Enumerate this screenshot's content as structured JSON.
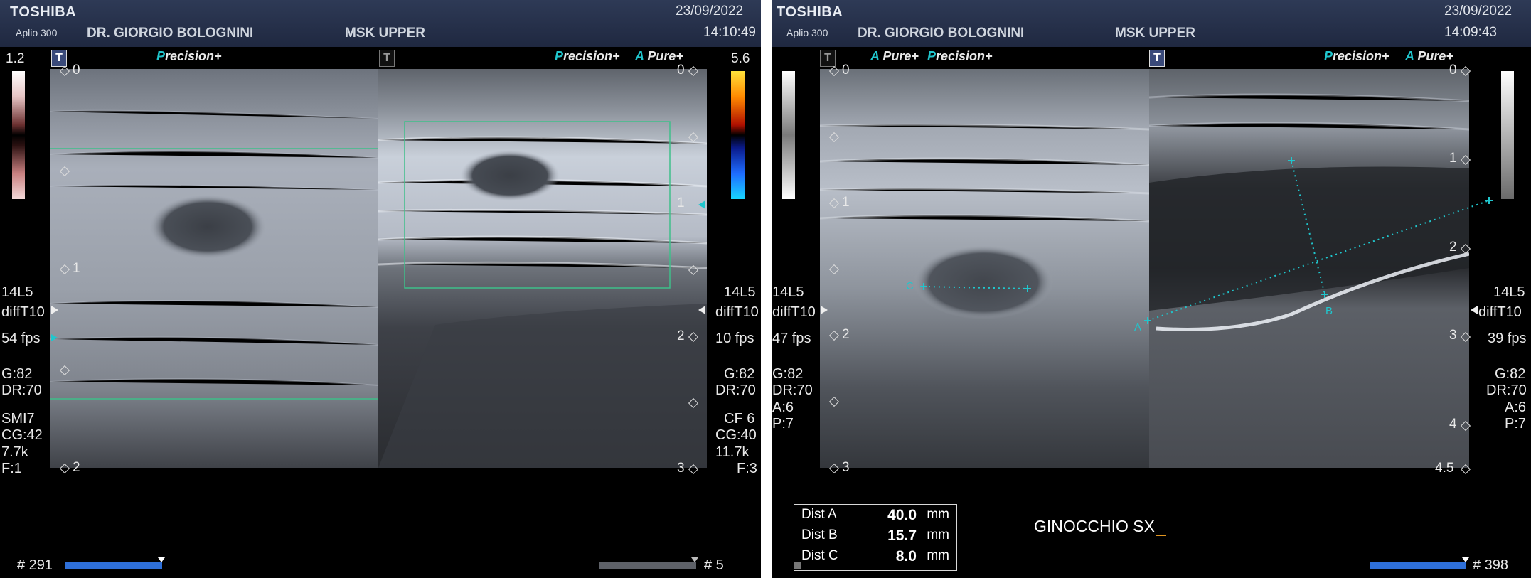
{
  "left": {
    "header": {
      "brand": "TOSHIBA",
      "model": "Aplio 300",
      "doctor": "DR. GIORGIO BOLOGNINI",
      "preset": "MSK UPPER",
      "date": "23/09/2022",
      "time": "14:10:49"
    },
    "scale_left": {
      "top": "1.2"
    },
    "scale_right": {
      "top": "5.6"
    },
    "badges": [
      {
        "prefix": "P",
        "rest": "recision",
        "suffix": "+"
      },
      {
        "prefix": "P",
        "rest": "recision",
        "suffix": "+"
      },
      {
        "prefix": "A",
        "rest": " Pure",
        "suffix": "+"
      }
    ],
    "t_label": "T",
    "depth_left": [
      "0",
      "1",
      "2"
    ],
    "depth_right": [
      "0",
      "1",
      "2",
      "3"
    ],
    "params_left": [
      "14L5",
      "diffT10",
      "54 fps",
      "G:82",
      "DR:70",
      "SMI7",
      "CG:42",
      "7.7k",
      "F:1"
    ],
    "params_right": [
      "14L5",
      "diffT10",
      "10 fps",
      "G:82",
      "DR:70",
      "CF 6",
      "CG:40",
      "11.7k",
      "F:3"
    ],
    "frame_left": "# 291",
    "frame_right": "# 5",
    "colors": {
      "cyan": "#20c6cd",
      "roi": "#3fbf8a",
      "bar": "#2e6fd8"
    }
  },
  "right": {
    "header": {
      "brand": "TOSHIBA",
      "model": "Aplio 300",
      "doctor": "DR. GIORGIO BOLOGNINI",
      "preset": "MSK UPPER",
      "date": "23/09/2022",
      "time": "14:09:43"
    },
    "badges_left": [
      {
        "prefix": "A",
        "rest": " Pure",
        "suffix": "+"
      },
      {
        "prefix": "P",
        "rest": "recision",
        "suffix": "+"
      }
    ],
    "badges_right": [
      {
        "prefix": "P",
        "rest": "recision",
        "suffix": "+"
      },
      {
        "prefix": "A",
        "rest": " Pure",
        "suffix": "+"
      }
    ],
    "t_label": "T",
    "depth_left": [
      "0",
      "1",
      "2",
      "3"
    ],
    "depth_right": [
      "0",
      "1",
      "2",
      "3",
      "4",
      "4.5"
    ],
    "params_left": [
      "14L5",
      "diffT10",
      "47 fps",
      "G:82",
      "DR:70",
      "A:6",
      "P:7"
    ],
    "params_right": [
      "14L5",
      "diffT10",
      "39 fps",
      "G:82",
      "DR:70",
      "A:6",
      "P:7"
    ],
    "markers": [
      "A",
      "B",
      "C"
    ],
    "measurements": [
      {
        "label": "Dist A",
        "value": "40.0",
        "unit": "mm"
      },
      {
        "label": "Dist B",
        "value": "15.7",
        "unit": "mm"
      },
      {
        "label": "Dist C",
        "value": "8.0",
        "unit": "mm"
      }
    ],
    "annotation": "GINOCCHIO SX",
    "frame": "# 398"
  }
}
